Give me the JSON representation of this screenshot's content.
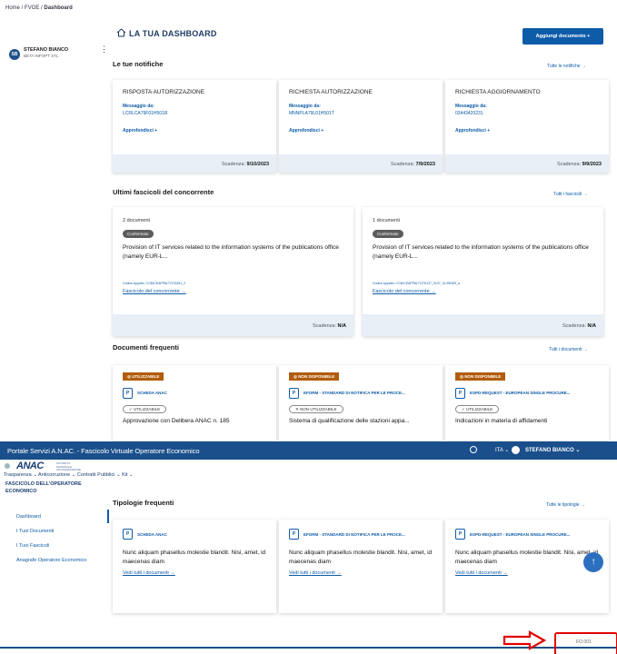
{
  "breadcrumb": {
    "home": "Home",
    "fvoe": "FVOE",
    "current": "Dashboard"
  },
  "user": {
    "initials": "SB",
    "name": "STEFANO BIANCO",
    "org": "BETA INFOPT STL"
  },
  "dashboard": {
    "title": "LA TUA DASHBOARD",
    "add_button": "Aggiungi documento +"
  },
  "notifications": {
    "title": "Le tue notifiche",
    "all_link": "Tutte le notifiche →",
    "cards": [
      {
        "title": "RISPOSTA AUTORIZZAZIONE",
        "msg_label": "Messaggio da:",
        "code": "LCRLCA79F01H501R",
        "action": "Approfondisci +",
        "due_label": "Scadenza:",
        "due": "9/10/2023"
      },
      {
        "title": "RICHIESTA AUTORIZZAZIONE",
        "msg_label": "Messaggio da:",
        "code": "MNNPLA79L01H501T",
        "action": "Approfondisci +",
        "due_label": "Scadenza:",
        "due": "7/9/2023"
      },
      {
        "title": "RICHIESTA AGGIORNAMENTO",
        "msg_label": "Messaggio da:",
        "code": "03443420231",
        "action": "Approfondisci +",
        "due_label": "Scadenza:",
        "due": "9/9/2023"
      }
    ]
  },
  "fascicoli": {
    "title": "Ultimi fascicoli del concorrente",
    "all_link": "Tutti i fascicoli →",
    "cards": [
      {
        "count": "2 documenti",
        "badge": "Confermato",
        "desc": "Provision of IT services related to the information systems of the publications office (namely EUR-L...",
        "code": "Codice Appalto: CODICEAPPALTO7DZ61_2",
        "link": "Fascicolo del concorrente →",
        "due_label": "Scadenza:",
        "due": "N/A"
      },
      {
        "count": "1 documenti",
        "badge": "Confermato",
        "desc": "Provision of IT services related to the information systems of the publications office (namely EUR-L...",
        "code": "Codice Appalto: CODICEAPPALTO7D127_3107_XLX5ND9_a",
        "link": "Fascicolo del concorrente →",
        "due_label": "Scadenza:",
        "due": "N/A"
      }
    ]
  },
  "frequenti": {
    "title": "Documenti frequenti",
    "all_link": "Tutti i documenti →",
    "cards": [
      {
        "status": "UTILIZZABILE",
        "type": "SCHEDA ANAC",
        "pill": "✓ UTILIZZABILE",
        "name": "Approvazione con Delibera ANAC n. 185"
      },
      {
        "status": "NON DISPONIBILE",
        "type": "EFORM - STANDARD DI NOTIFICA PER LE PROCE...",
        "pill": "✕ NON UTILIZZABILE",
        "name": "Sistema di qualificazione delle stazioni appa..."
      },
      {
        "status": "NON DISPONIBILE",
        "type": "ESPD-REQUEST - EUROPEAN SINGLE PROCURE...",
        "pill": "✓ UTILIZZABILE",
        "name": "Indicazioni in materia di affidamenti"
      }
    ]
  },
  "portal": {
    "title": "Portale Servizi A.N.AC. - Fascicolo Virtuale Operatore Economico",
    "lang": "ITA ⌄",
    "user": "STEFANO BIANCO ⌄",
    "logo": "ANAC",
    "logo_sub": "AUTORITÀ NAZIONALE ANTICORRUZIONE",
    "menu": "Trasparenza ⌄   Anticorruzione ⌄   Contratti Pubblici ⌄   Kit ⌄"
  },
  "side_nav": {
    "heading": "FASCICOLO DELL'OPERATORE ECONOMICO",
    "items": [
      "Dashboard",
      "I Tuoi Documenti",
      "I Tuoi Fascicoli",
      "Anagrafe Operatore Economico"
    ]
  },
  "tipologie": {
    "title": "Tipologie frequenti",
    "all_link": "Tutte le tipologie →",
    "cards": [
      {
        "type": "SCHEDA ANAC",
        "desc": "Nunc aliquam phasellus molestie blandit. Nisi, amet, id maecenas diam",
        "link": "Vedi tutti i documenti →"
      },
      {
        "type": "EFORM - STANDARD DI NOTIFICA PER LE PROCE...",
        "desc": "Nunc aliquam phasellus molestie blandit. Nisi, amet, id maecenas diam",
        "link": "Vedi tutti i documenti →"
      },
      {
        "type": "ESPD-REQUEST - EUROPEAN SINGLE PROCURE...",
        "desc": "Nunc aliquam phasellus molestie blandit. Nisi, amet, id maecenas diam",
        "link": "Vedi tutti i documenti →"
      }
    ]
  },
  "page_code": "FO.001",
  "colors": {
    "primary": "#0e5ba8",
    "portal_bar": "#1a4f8b",
    "status_orange": "#b15c0a",
    "annotation_red": "#e00000"
  },
  "icons": {
    "home": "home-icon",
    "doc": "document-icon",
    "fab": "arrow-up-icon"
  }
}
